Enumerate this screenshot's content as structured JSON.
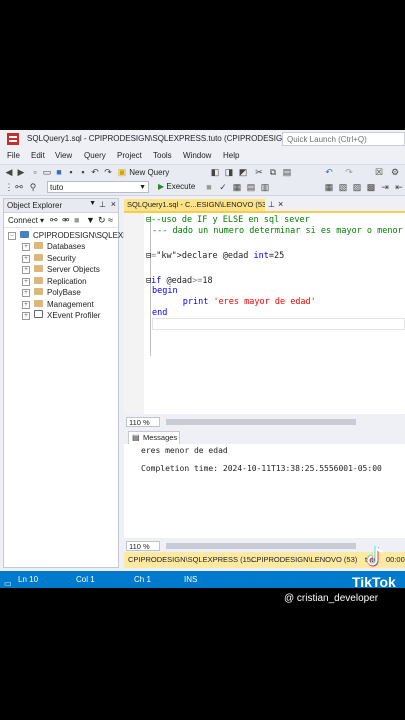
{
  "window": {
    "title": "SQLQuery1.sql - CPIPRODESIGN\\SQLEXPRESS.tuto (CPIPRODESIGN\\LENO...",
    "quick_launch_placeholder": "Quick Launch (Ctrl+Q)"
  },
  "menu": [
    "File",
    "Edit",
    "View",
    "Query",
    "Project",
    "Tools",
    "Window",
    "Help"
  ],
  "toolbar": {
    "new_query_label": "New Query",
    "database_value": "tuto",
    "execute_label": "Execute"
  },
  "object_explorer": {
    "title": "Object Explorer",
    "connect_label": "Connect",
    "server": "CPIPRODESIGN\\SQLEXPR",
    "items": [
      "Databases",
      "Security",
      "Server Objects",
      "Replication",
      "PolyBase",
      "Management",
      "XEvent Profiler"
    ]
  },
  "document_tab": {
    "label": "SQLQuery1.sql - C...ESIGN\\LENOVO (53))*"
  },
  "editor": {
    "lines": [
      "--uso de IF y ELSE en sql sever",
      "--- dado un numero determinar si es mayor o menor",
      "",
      "declare @edad int=25",
      "",
      "if @edad>=18",
      "begin",
      "      print 'eres mayor de edad'",
      "end"
    ],
    "zoom": "110 %"
  },
  "results": {
    "tab_label": "Messages",
    "message": "eres menor de edad",
    "completion": "Completion time: 2024-10-11T13:38:25.5556001-05:00",
    "zoom": "110 %"
  },
  "query_status": {
    "server": "CPIPRODESIGN\\SQLEXPRESS (15...",
    "user": "CPIPRODESIGN\\LENOVO (53)",
    "db": "tuto",
    "time": "00:00:0"
  },
  "statusbar": {
    "ln": "Ln 10",
    "col": "Col 1",
    "ch": "Ch 1",
    "mode": "INS"
  },
  "overlay": {
    "brand": "TikTok",
    "user": "@ cristian_developer"
  },
  "colors": {
    "accent": "#007acc",
    "tab_active": "#fce38a",
    "comment": "#008000",
    "keyword": "#0000ff",
    "string": "#ff0000"
  }
}
